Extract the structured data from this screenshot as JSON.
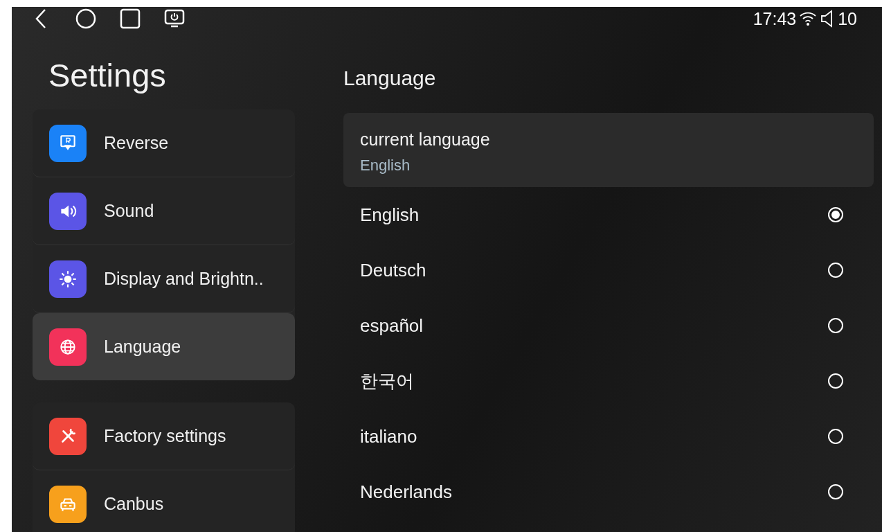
{
  "status_bar": {
    "time": "17:43",
    "volume": "10"
  },
  "sidebar": {
    "title": "Settings",
    "groups": [
      {
        "items": [
          {
            "label": "Reverse",
            "kind": "reverse",
            "color": "#1a82f7",
            "selected": false
          },
          {
            "label": "Sound",
            "kind": "sound",
            "color": "#5b55e6",
            "selected": false
          },
          {
            "label": "Display and Brightn..",
            "kind": "brightness",
            "color": "#5b55e6",
            "selected": false
          },
          {
            "label": "Language",
            "kind": "globe",
            "color": "#f2325a",
            "selected": true
          }
        ]
      },
      {
        "items": [
          {
            "label": "Factory settings",
            "kind": "tools",
            "color": "#f0463c",
            "selected": false
          },
          {
            "label": "Canbus",
            "kind": "car",
            "color": "#f7a01c",
            "selected": false
          }
        ]
      }
    ]
  },
  "content": {
    "title": "Language",
    "current": {
      "label": "current language",
      "value": "English"
    },
    "options": [
      {
        "label": "English",
        "selected": true
      },
      {
        "label": "Deutsch",
        "selected": false
      },
      {
        "label": "español",
        "selected": false
      },
      {
        "label": "한국어",
        "selected": false
      },
      {
        "label": "italiano",
        "selected": false
      },
      {
        "label": "Nederlands",
        "selected": false
      }
    ]
  }
}
